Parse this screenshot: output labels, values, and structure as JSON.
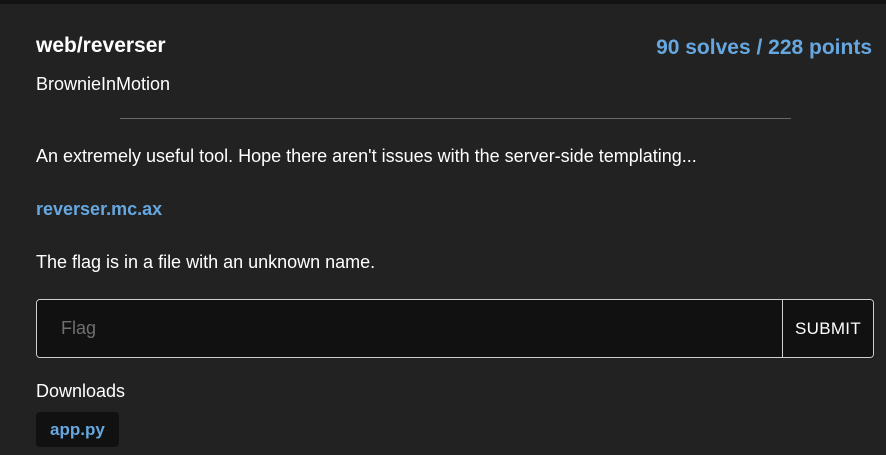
{
  "challenge": {
    "title": "web/reverser",
    "solves_points": "90 solves / 228 points",
    "author": "BrownieInMotion",
    "description": "An extremely useful tool. Hope there aren't issues with the server-side templating...",
    "link_text": "reverser.mc.ax",
    "hint": "The flag is in a file with an unknown name."
  },
  "flag_form": {
    "placeholder": "Flag",
    "value": "",
    "submit_label": "SUBMIT"
  },
  "downloads": {
    "label": "Downloads",
    "files": [
      {
        "name": "app.py"
      }
    ]
  },
  "colors": {
    "background": "#222222",
    "accent": "#66a7e0",
    "input_background": "#111111",
    "border": "#cfcfcf"
  }
}
